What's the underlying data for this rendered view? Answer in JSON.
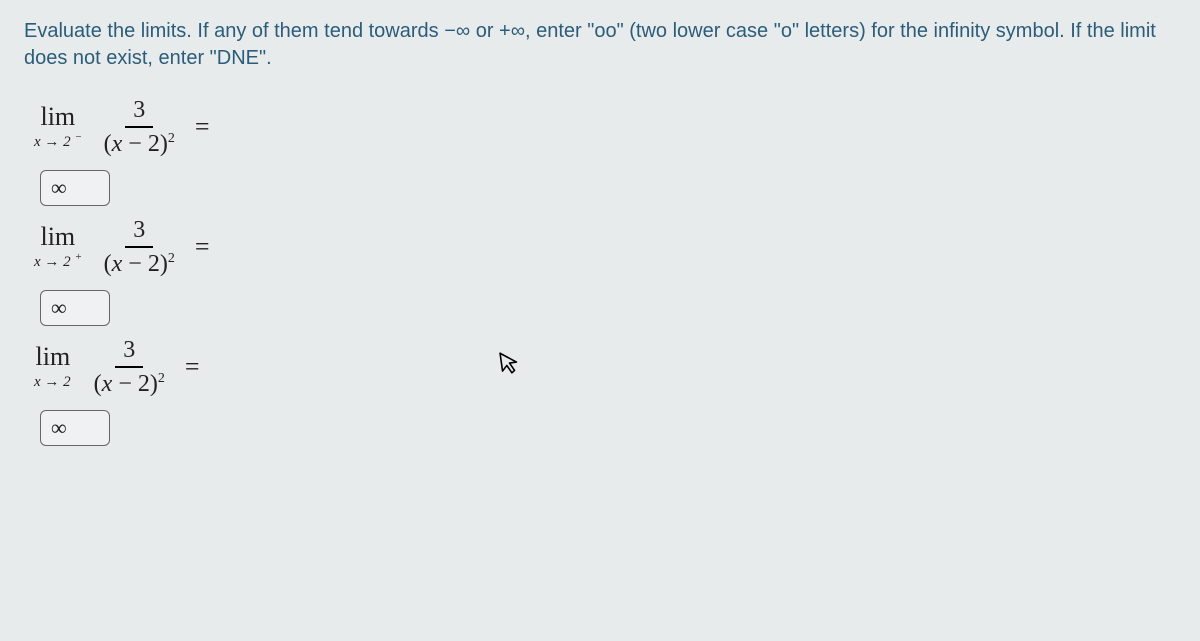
{
  "instructions": "Evaluate the limits. If any of them tend towards −∞ or +∞, enter \"oo\" (two lower case \"o\" letters) for the infinity symbol. If the limit does not exist, enter \"DNE\".",
  "limits": [
    {
      "lim_label": "lim",
      "sub_var": "x",
      "sub_arrow": "→",
      "sub_target": "2",
      "sub_side": "−",
      "numerator": "3",
      "den_left": "(",
      "den_x": "x",
      "den_rest": " − 2)",
      "den_exp": "2",
      "equals": "=",
      "answer": "∞"
    },
    {
      "lim_label": "lim",
      "sub_var": "x",
      "sub_arrow": "→",
      "sub_target": "2",
      "sub_side": "+",
      "numerator": "3",
      "den_left": "(",
      "den_x": "x",
      "den_rest": " − 2)",
      "den_exp": "2",
      "equals": "=",
      "answer": "∞"
    },
    {
      "lim_label": "lim",
      "sub_var": "x",
      "sub_arrow": "→",
      "sub_target": "2",
      "sub_side": "",
      "numerator": "3",
      "den_left": "(",
      "den_x": "x",
      "den_rest": " − 2)",
      "den_exp": "2",
      "equals": "=",
      "answer": "∞"
    }
  ]
}
